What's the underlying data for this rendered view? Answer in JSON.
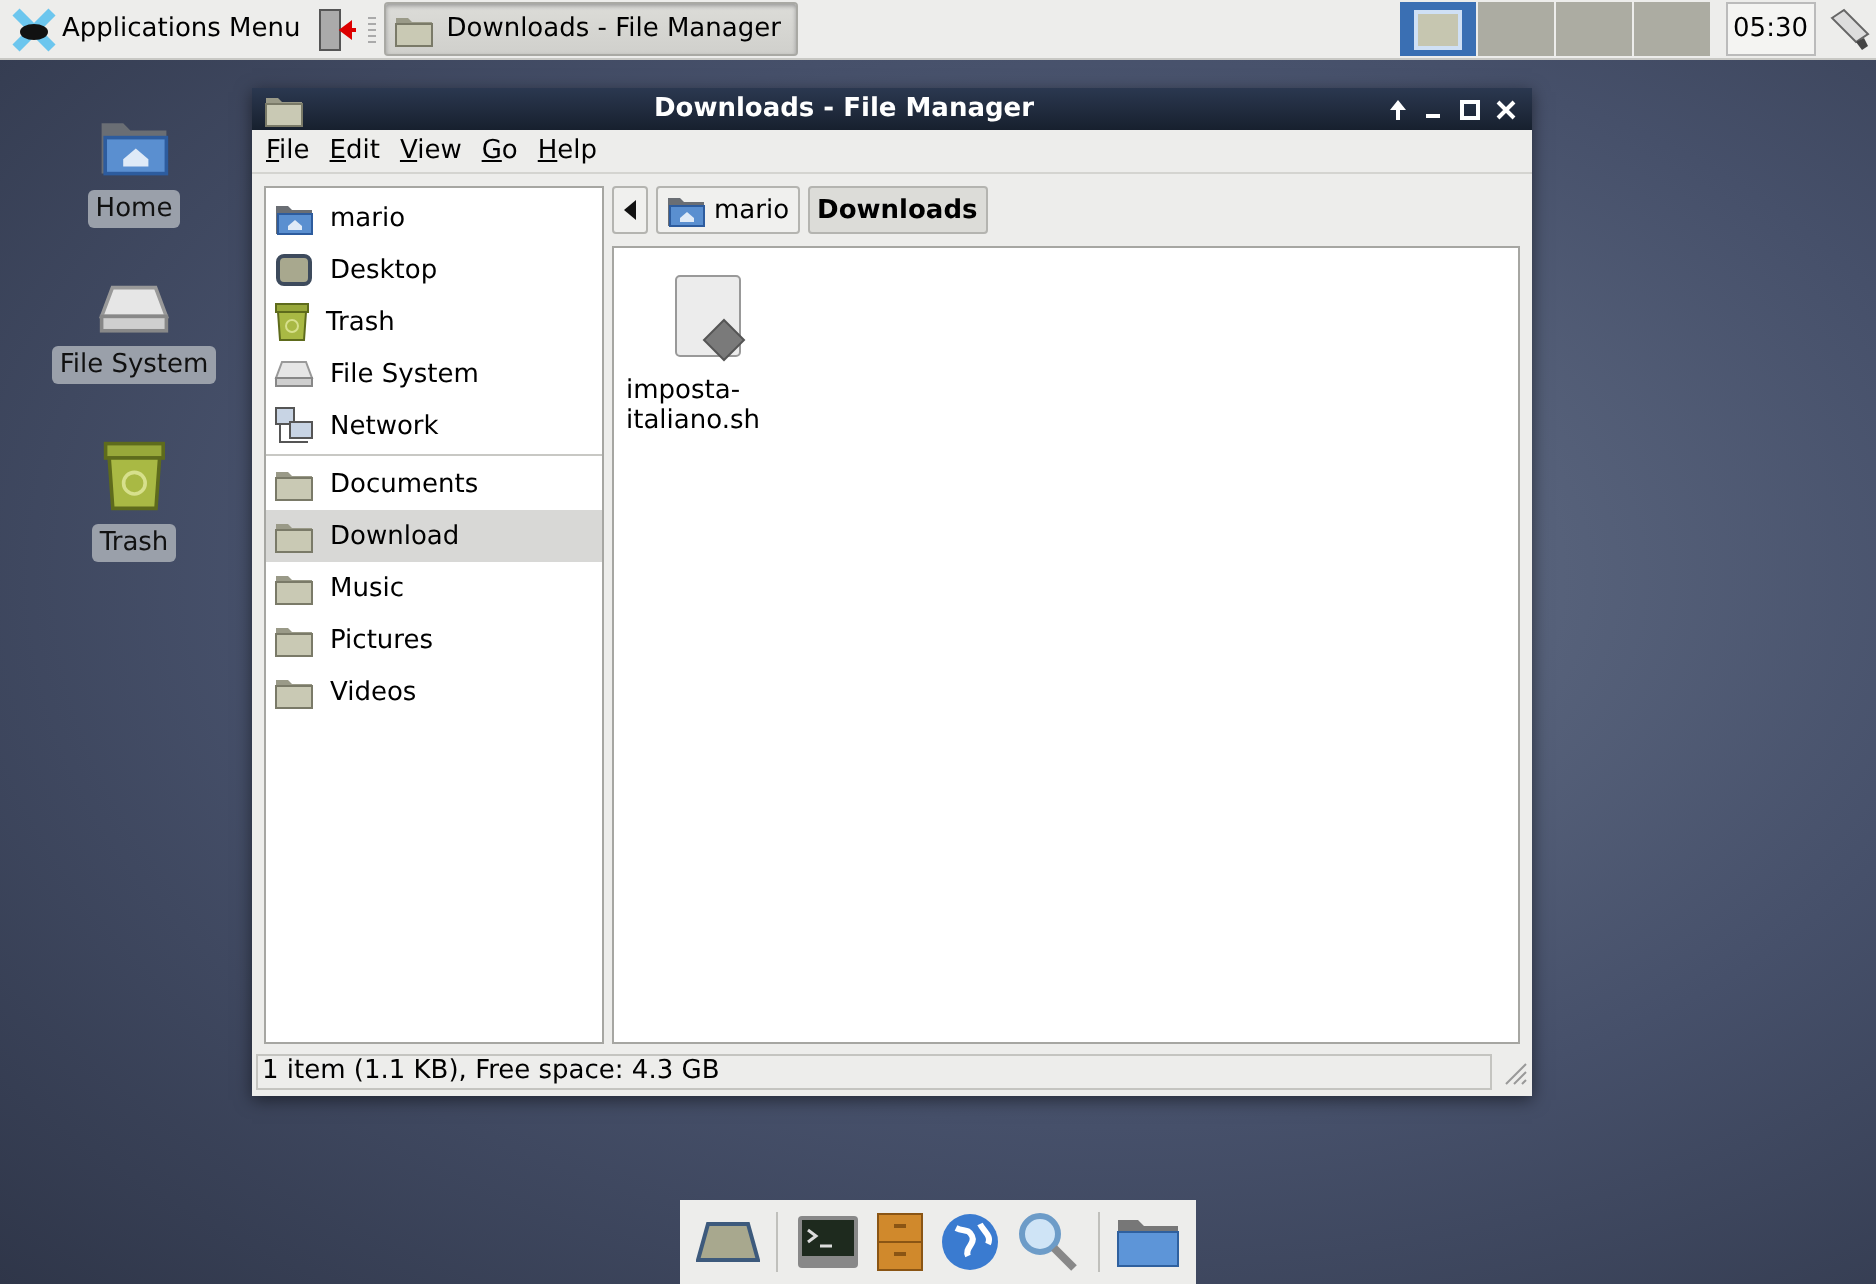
{
  "panel": {
    "app_menu": "Applications Menu",
    "tasks": [
      {
        "label": "Downloads - File Manager",
        "active": true
      }
    ],
    "workspaces": [
      {
        "selected": true
      },
      {
        "selected": false
      },
      {
        "selected": false
      },
      {
        "selected": false
      }
    ],
    "clock": "05:30"
  },
  "desktop_icons": [
    {
      "label": "Home",
      "kind": "home"
    },
    {
      "label": "File System",
      "kind": "drive"
    },
    {
      "label": "Trash",
      "kind": "trash"
    }
  ],
  "window": {
    "title": "Downloads - File Manager",
    "menu": [
      "File",
      "Edit",
      "View",
      "Go",
      "Help"
    ],
    "sidebar": {
      "devices": [
        {
          "label": "mario",
          "kind": "home",
          "selected": false
        },
        {
          "label": "Desktop",
          "kind": "desktop",
          "selected": false
        },
        {
          "label": "Trash",
          "kind": "trash",
          "selected": false
        },
        {
          "label": "File System",
          "kind": "drive",
          "selected": false
        },
        {
          "label": "Network",
          "kind": "network",
          "selected": false
        }
      ],
      "places": [
        {
          "label": "Documents",
          "kind": "folder",
          "selected": false
        },
        {
          "label": "Download",
          "kind": "folder",
          "selected": true
        },
        {
          "label": "Music",
          "kind": "folder",
          "selected": false
        },
        {
          "label": "Pictures",
          "kind": "folder",
          "selected": false
        },
        {
          "label": "Videos",
          "kind": "folder",
          "selected": false
        }
      ]
    },
    "path": [
      {
        "label": "mario",
        "selected": false
      },
      {
        "label": "Downloads",
        "selected": true
      }
    ],
    "files": [
      {
        "name": "imposta-italiano.sh",
        "kind": "script"
      }
    ],
    "status": "1 item (1.1 KB), Free space: 4.3 GB"
  }
}
